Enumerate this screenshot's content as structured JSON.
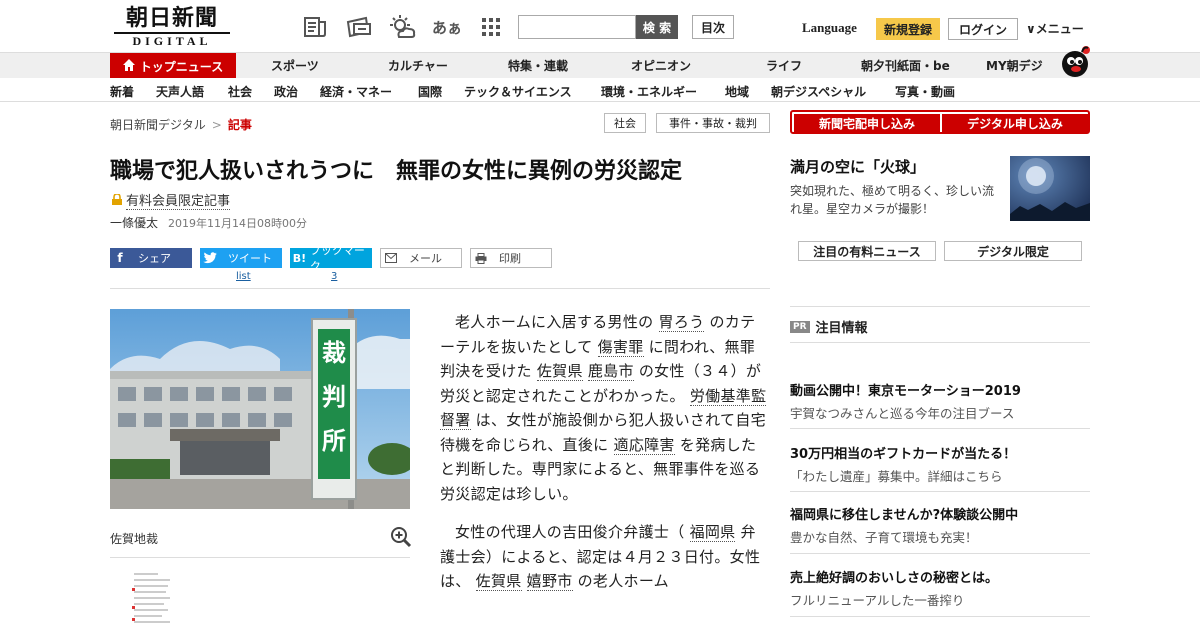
{
  "header": {
    "logo_jp": "朝日新聞",
    "logo_en": "DIGITAL",
    "search_button": "検 索",
    "contents_button": "目次",
    "language": "Language",
    "signup": "新規登録",
    "login": "ログイン",
    "menu": "メニュー",
    "icon_moji": "あぁ"
  },
  "nav_main": {
    "top": "トップニュース",
    "items": [
      "スポーツ",
      "カルチャー",
      "特集・連載",
      "オピニオン",
      "ライフ",
      "朝夕刊紙面・be",
      "MY朝デジ"
    ]
  },
  "nav_sub": {
    "items": [
      "新着",
      "天声人語",
      "社会",
      "政治",
      "経済・マネー",
      "国際",
      "テック＆サイエンス",
      "環境・エネルギー",
      "地域",
      "朝デジスペシャル",
      "写真・動画"
    ]
  },
  "breadcrumb": {
    "home": "朝日新聞デジタル",
    "sep": ">",
    "current": "記事"
  },
  "tags": [
    "社会",
    "事件・事故・裁判"
  ],
  "article": {
    "title": "職場で犯人扱いされうつに　無罪の女性に異例の労災認定",
    "member_label": "有料会員限定記事",
    "author": "一條優太",
    "date": "2019年11月14日08時00分",
    "photo_sign": [
      "裁",
      "判",
      "所"
    ],
    "caption": "佐賀地裁",
    "p1": [
      {
        "t": "老人ホームに入居する男性の "
      },
      {
        "t": "胃ろう",
        "link": true
      },
      {
        "t": " のカテーテルを抜いたとして "
      },
      {
        "t": "傷害罪",
        "link": true
      },
      {
        "t": " に問われ、無罪判決を受けた "
      },
      {
        "t": "佐賀県",
        "link": true
      },
      {
        "t": " "
      },
      {
        "t": "鹿島市",
        "link": true
      },
      {
        "t": " の女性（３４）が労災と認定されたことがわかった。 "
      },
      {
        "t": "労働基準監督署",
        "link": true
      },
      {
        "t": " は、女性が施設側から犯人扱いされて自宅待機を命じられ、直後に "
      },
      {
        "t": "適応障害",
        "link": true
      },
      {
        "t": " を発病したと判断した。専門家によると、無罪事件を巡る労災認定は珍しい。"
      }
    ],
    "p2": [
      {
        "t": "女性の代理人の吉田俊介弁護士（ "
      },
      {
        "t": "福岡県",
        "link": true
      },
      {
        "t": " 弁護士会）によると、認定は４月２３日付。女性は、 "
      },
      {
        "t": "佐賀県",
        "link": true
      },
      {
        "t": " "
      },
      {
        "t": "嬉野市",
        "link": true
      },
      {
        "t": " の老人ホーム"
      }
    ]
  },
  "share": {
    "facebook": "シェア",
    "twitter": "ツイート",
    "twitter_count": "list",
    "bookmark": "ブックマーク",
    "bookmark_count": "3",
    "mail": "メール",
    "print": "印刷"
  },
  "sidebar": {
    "delivery": "新聞宅配申し込み",
    "digital": "デジタル申し込み",
    "feature_title": "満月の空に「火球」",
    "feature_desc": "突如現れた、極めて明るく、珍しい流れ星。星空カメラが撮影！",
    "premium_news": "注目の有料ニュース",
    "digital_only": "デジタル限定",
    "pr_badge": "PR",
    "pr_title": "注目情報",
    "ads": [
      {
        "title": "動画公開中！東京モーターショー2019",
        "desc": "宇賀なつみさんと巡る今年の注目ブース"
      },
      {
        "title": "30万円相当のギフトカードが当たる！",
        "desc": "「わたし遺産」募集中。詳細はこちら"
      },
      {
        "title": "福岡県に移住しませんか?体験談公開中",
        "desc": "豊かな自然、子育て環境も充実！"
      },
      {
        "title": "売上絶好調のおいしさの秘密とは。",
        "desc": "フルリニューアルした一番搾り"
      }
    ]
  }
}
